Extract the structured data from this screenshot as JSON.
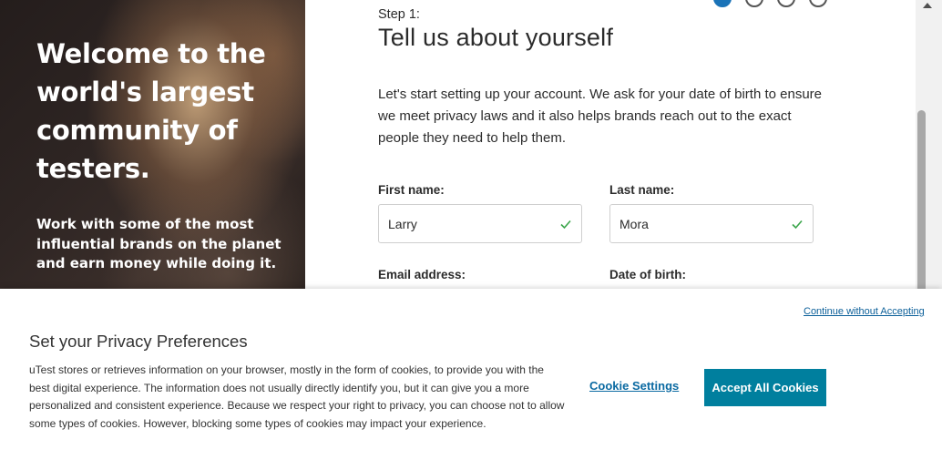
{
  "hero": {
    "title": "Welcome to the world's largest community of testers.",
    "subtitle": "Work with some of the most influential brands on the planet and earn money while doing it."
  },
  "form": {
    "step_label": "Step 1:",
    "title": "Tell us about yourself",
    "intro": "Let's start setting up your account. We ask for your date of birth to ensure we meet privacy laws and it also helps brands reach out to the exact people they need to help them.",
    "first_name": {
      "label": "First name:",
      "value": "Larry",
      "valid_icon": "check-icon"
    },
    "last_name": {
      "label": "Last name:",
      "value": "Mora",
      "valid_icon": "check-icon"
    },
    "email": {
      "label": "Email address:"
    },
    "dob": {
      "label": "Date of birth:"
    },
    "steps": [
      {
        "state": "active"
      },
      {
        "state": "inactive"
      },
      {
        "state": "inactive"
      },
      {
        "state": "inactive"
      }
    ]
  },
  "cookie": {
    "continue_link": "Continue without Accepting",
    "title": "Set your Privacy Preferences",
    "text": "uTest stores or retrieves information on your browser, mostly in the form of cookies, to provide you with the best digital experience. The information does not usually directly identify you, but it can give you a more personalized and consistent experience. Because we respect your right to privacy, you can choose not to allow some types of cookies. However, blocking some types of cookies may impact your experience.",
    "settings_label": "Cookie Settings",
    "accept_label": "Accept All Cookies"
  },
  "colors": {
    "accent": "#1a73b8",
    "accept_button": "#007f9e",
    "link": "#0b6aa2",
    "check": "#3aa54a"
  }
}
